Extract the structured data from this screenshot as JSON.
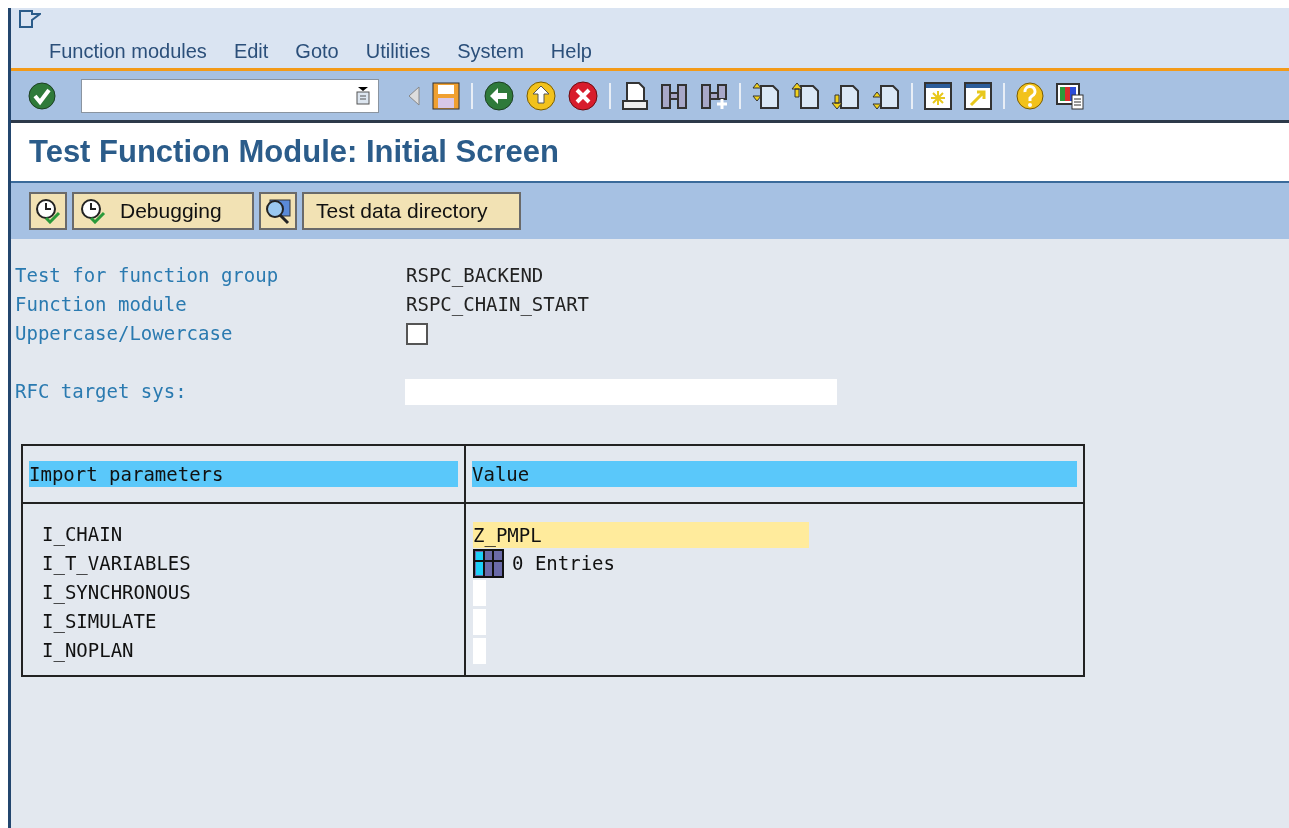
{
  "menu": [
    "Function modules",
    "Edit",
    "Goto",
    "Utilities",
    "System",
    "Help"
  ],
  "title": "Test Function Module: Initial Screen",
  "app_toolbar": [
    {
      "kind": "icon"
    },
    {
      "kind": "icon_text",
      "label": "Debugging"
    },
    {
      "kind": "search"
    },
    {
      "kind": "text",
      "label": "Test data directory"
    }
  ],
  "form": [
    {
      "label": "Test for function group",
      "value": "RSPC_BACKEND"
    },
    {
      "label": "Function module",
      "value": "RSPC_CHAIN_START"
    },
    {
      "label": "Uppercase/Lowercase",
      "kind": "checkbox",
      "checked": false
    }
  ],
  "rfc": {
    "label": "RFC target sys:"
  },
  "table": {
    "columns": [
      "Import parameters",
      "Value"
    ],
    "rows": [
      {
        "name": "I_CHAIN",
        "kind": "text",
        "value": "Z_PMPL"
      },
      {
        "name": "I_T_VARIABLES",
        "kind": "table",
        "value": "0 Entries"
      },
      {
        "name": "I_SYNCHRONOUS",
        "kind": "empty"
      },
      {
        "name": "I_SIMULATE",
        "kind": "empty"
      },
      {
        "name": "I_NOPLAN",
        "kind": "empty"
      }
    ]
  }
}
